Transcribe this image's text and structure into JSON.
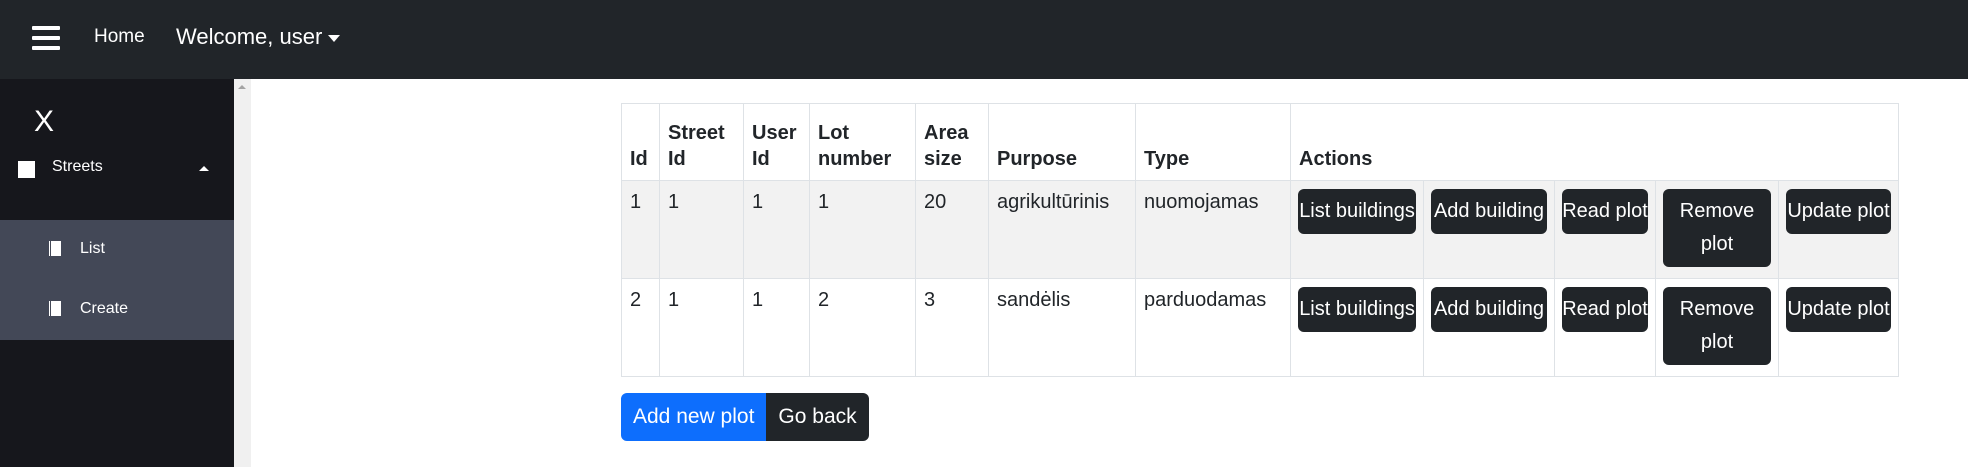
{
  "nav": {
    "home": "Home",
    "user": "Welcome, user"
  },
  "sidebar": {
    "close": "X",
    "section": "Streets",
    "items": [
      {
        "label": "List"
      },
      {
        "label": "Create"
      }
    ]
  },
  "table": {
    "headers": [
      "Id",
      "Street Id",
      "User Id",
      "Lot number",
      "Area size",
      "Purpose",
      "Type",
      "Actions"
    ],
    "rows": [
      {
        "id": "1",
        "street_id": "1",
        "user_id": "1",
        "lot": "1",
        "area": "20",
        "purpose": "agrikultūrinis",
        "type": "nuomojamas"
      },
      {
        "id": "2",
        "street_id": "1",
        "user_id": "1",
        "lot": "2",
        "area": "3",
        "purpose": "sandėlis",
        "type": "parduodamas"
      }
    ],
    "actions": [
      "List buildings",
      "Add building",
      "Read plot",
      "Remove plot",
      "Update plot"
    ]
  },
  "buttons": {
    "add": "Add new plot",
    "back": "Go back"
  }
}
